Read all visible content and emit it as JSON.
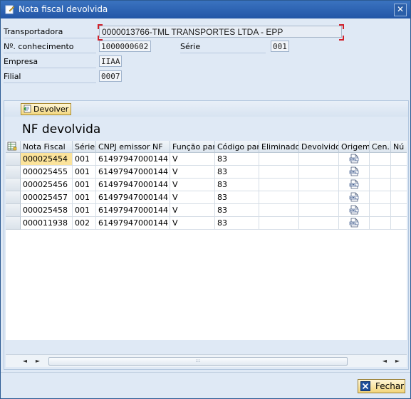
{
  "window": {
    "title": "Nota fiscal devolvida",
    "close_glyph": "✕"
  },
  "header": {
    "transportadora": {
      "label": "Transportadora",
      "value": "0000013766-TML TRANSPORTES LTDA - EPP"
    },
    "conhecimento": {
      "label": "Nº. conhecimento",
      "value": "1000000602"
    },
    "serie": {
      "label": "Série",
      "value": "001"
    },
    "empresa": {
      "label": "Empresa",
      "value": "IIAA"
    },
    "filial": {
      "label": "Filial",
      "value": "0007"
    }
  },
  "toolbar": {
    "devolver_label": "Devolver"
  },
  "grid": {
    "title": "NF devolvida",
    "columns": [
      "Nota Fiscal",
      "Série",
      "CNPJ emissor NF",
      "Função par",
      "Código par",
      "Eliminado",
      "Devolvido",
      "Origem",
      "Cen.",
      "Nú"
    ],
    "rows": [
      {
        "nota": "000025454",
        "serie": "001",
        "cnpj": "61497947000144",
        "funcao": "V",
        "codigo": "83",
        "origem_icon": "xml-document-icon"
      },
      {
        "nota": "000025455",
        "serie": "001",
        "cnpj": "61497947000144",
        "funcao": "V",
        "codigo": "83",
        "origem_icon": "xml-document-icon"
      },
      {
        "nota": "000025456",
        "serie": "001",
        "cnpj": "61497947000144",
        "funcao": "V",
        "codigo": "83",
        "origem_icon": "xml-document-icon"
      },
      {
        "nota": "000025457",
        "serie": "001",
        "cnpj": "61497947000144",
        "funcao": "V",
        "codigo": "83",
        "origem_icon": "xml-document-icon"
      },
      {
        "nota": "000025458",
        "serie": "001",
        "cnpj": "61497947000144",
        "funcao": "V",
        "codigo": "83",
        "origem_icon": "xml-document-icon"
      },
      {
        "nota": "000011938",
        "serie": "002",
        "cnpj": "61497947000144",
        "funcao": "V",
        "codigo": "83",
        "origem_icon": "xml-document-icon"
      }
    ]
  },
  "scrollbar": {
    "left_glyph": "◄",
    "right_glyph": "►",
    "grip": ":::"
  },
  "footer": {
    "fechar_label": "Fechar"
  },
  "colors": {
    "titlebar": "#2356a6",
    "highlight": "#fbe39b",
    "background": "#dfe9f5"
  }
}
